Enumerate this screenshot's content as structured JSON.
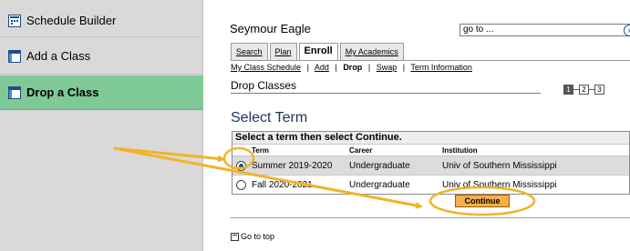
{
  "nav": {
    "items": [
      {
        "label": "Schedule Builder",
        "icon": "calendar-icon"
      },
      {
        "label": "Add a Class",
        "icon": "window-icon"
      },
      {
        "label": "Drop a Class",
        "icon": "window-icon"
      }
    ]
  },
  "header": {
    "username": "Seymour Eagle",
    "goto_value": "go to ...",
    "goto_arrow": "⌄",
    "goto_button": "»"
  },
  "tabs": {
    "items": [
      "Search",
      "Plan",
      "Enroll",
      "My Academics"
    ],
    "active": "Enroll"
  },
  "subtabs": {
    "items": [
      "My Class Schedule",
      "|",
      "Add",
      "|",
      "Drop",
      "|",
      "Swap",
      "|",
      "Term Information"
    ],
    "current": "Drop"
  },
  "page": {
    "title": "Drop Classes",
    "steps": [
      "1",
      "2",
      "3"
    ],
    "section_title": "Select Term"
  },
  "grid": {
    "caption": "Select a term then select Continue.",
    "headers": {
      "term": "Term",
      "career": "Career",
      "institution": "Institution"
    },
    "rows": [
      {
        "term": "Summer 2019-2020",
        "career": "Undergraduate",
        "institution": "Univ of Southern Mississippi",
        "selected": true
      },
      {
        "term": "Fall 2020-2021",
        "career": "Undergraduate",
        "institution": "Univ of Southern Mississippi",
        "selected": false
      }
    ]
  },
  "actions": {
    "continue_label": "Continue",
    "go_to_top": "Go to top"
  },
  "colors": {
    "nav_bg": "#d9d9d9",
    "nav_active": "#7fc996",
    "annotation": "#f0b429",
    "continue_btn": "#f3b04a",
    "section_title": "#1d3557"
  }
}
